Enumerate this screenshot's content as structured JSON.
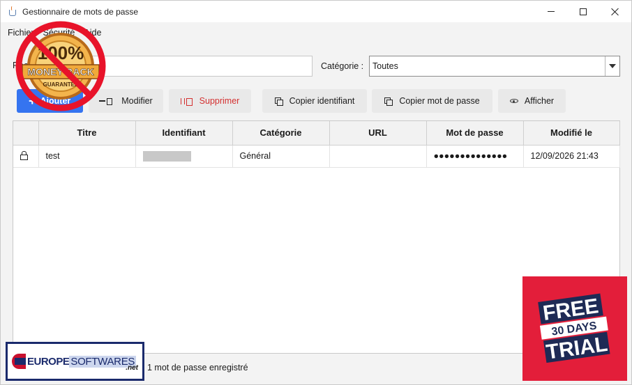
{
  "window": {
    "title": "Gestionnaire de mots de passe"
  },
  "menu": [
    "Fichier",
    "Sécurité",
    "Aide"
  ],
  "search": {
    "label": "Rechercher :",
    "value": ""
  },
  "category": {
    "label": "Catégorie :",
    "selected": "Toutes"
  },
  "toolbar": {
    "add_label": "Ajouter",
    "edit_label": "Modifier",
    "delete_label": "Supprimer",
    "copy_id_label": "Copier identifiant",
    "copy_pw_label": "Copier mot de passe",
    "show_label": "Afficher"
  },
  "table": {
    "columns": [
      "",
      "Titre",
      "Identifiant",
      "Catégorie",
      "URL",
      "Mot de passe",
      "Modifié le"
    ],
    "rows": [
      {
        "title": "test",
        "identifier": "",
        "category": "Général",
        "url": "",
        "password": "●●●●●●●●●●●●●●",
        "modified": "12/09/2026 21:43"
      }
    ]
  },
  "status": {
    "text": "1 mot de passe enregistré"
  },
  "overlays": {
    "guarantee_100": "100%",
    "guarantee_money": "MONEY BACK",
    "guarantee_sub": "GUARANTEE",
    "europe_1": "EUROPE",
    "europe_2": "SOFTWARES",
    "europe_3": ".net",
    "trial_free": "FREE",
    "trial_days": "30 DAYS",
    "trial_trial": "TRIAL"
  },
  "colors": {
    "accent": "#3574f0",
    "danger": "#d43030",
    "trial_red": "#e31e3a",
    "europe_navy": "#1a2a6c"
  }
}
